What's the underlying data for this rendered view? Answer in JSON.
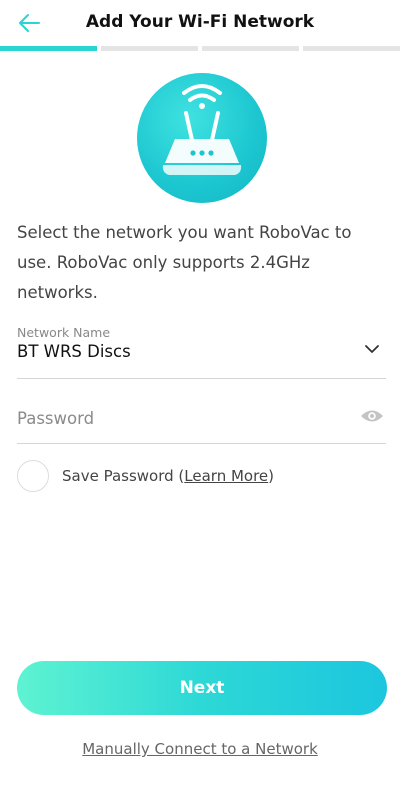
{
  "header": {
    "title": "Add Your Wi-Fi Network",
    "back_icon": "arrow-left-icon"
  },
  "progress": {
    "total_steps": 4,
    "current_step": 1
  },
  "hero": {
    "icon": "wifi-router-icon"
  },
  "description": "Select the network you want RoboVac to use. RoboVac only supports 2.4GHz networks.",
  "network": {
    "label": "Network Name",
    "value": "BT WRS Discs",
    "icon": "chevron-down-icon"
  },
  "password": {
    "placeholder": "Password",
    "value": "",
    "icon": "eye-icon"
  },
  "save_password": {
    "label_prefix": "Save Password (",
    "learn_more": "Learn More",
    "label_suffix": ")",
    "checked": false
  },
  "buttons": {
    "next": "Next",
    "manual": "Manually Connect to a Network"
  },
  "colors": {
    "accent": "#2ad4d0",
    "button_start": "#5ef3d2",
    "button_end": "#1cc6de"
  }
}
